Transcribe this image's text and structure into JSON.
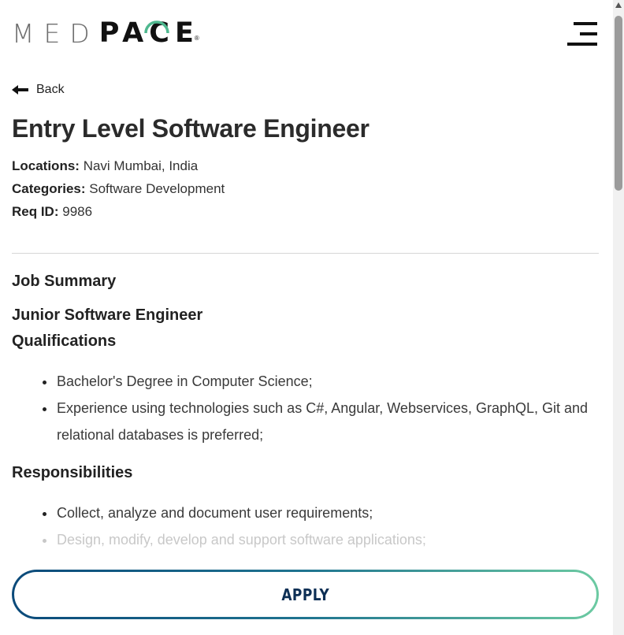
{
  "brand": {
    "logo_left": "MED",
    "logo_right": "PACE",
    "registered_mark": "®",
    "accent": "#4fb88f"
  },
  "nav": {
    "back_label": "Back"
  },
  "job": {
    "title": "Entry Level Software Engineer",
    "locations_label": "Locations:",
    "locations_value": "Navi Mumbai, India",
    "categories_label": "Categories:",
    "categories_value": "Software Development",
    "reqid_label": "Req ID:",
    "reqid_value": "9986"
  },
  "sections": {
    "job_summary": "Job Summary",
    "role": "Junior Software Engineer",
    "qualifications_heading": "Qualifications",
    "qualifications": [
      "Bachelor's Degree in Computer Science;",
      "Experience using technologies such as C#, Angular, Webservices, GraphQL, Git and relational databases is preferred;"
    ],
    "responsibilities_heading": "Responsibilities",
    "responsibilities": [
      "Collect, analyze and document user requirements;",
      "Design, modify, develop and support software applications;"
    ]
  },
  "actions": {
    "apply_label": "APPLY"
  },
  "icons": {
    "back": "arrow-left-icon",
    "menu": "hamburger-menu-icon"
  },
  "colors": {
    "apply_gradient_start": "#0b4a7a",
    "apply_gradient_end": "#6ccaa2",
    "apply_text": "#0d2f55"
  }
}
